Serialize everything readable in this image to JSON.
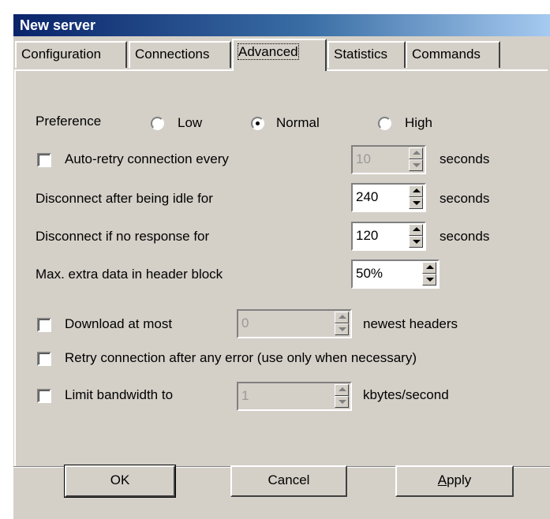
{
  "window": {
    "title": "New server"
  },
  "tabs": [
    {
      "label": "Configuration"
    },
    {
      "label": "Connections"
    },
    {
      "label": "Advanced",
      "active": true
    },
    {
      "label": "Statistics"
    },
    {
      "label": "Commands"
    }
  ],
  "preference": {
    "label": "Preference",
    "options": [
      {
        "label": "Low",
        "selected": false
      },
      {
        "label": "Normal",
        "selected": true
      },
      {
        "label": "High",
        "selected": false
      }
    ]
  },
  "auto_retry": {
    "label": "Auto-retry connection every",
    "checked": false,
    "value": "10",
    "unit": "seconds",
    "enabled": false
  },
  "idle_disconnect": {
    "label": "Disconnect after being idle for",
    "value": "240",
    "unit": "seconds"
  },
  "no_response": {
    "label": "Disconnect if no response for",
    "value": "120",
    "unit": "seconds"
  },
  "max_extra": {
    "label": "Max. extra data in header block",
    "value": "50%"
  },
  "download_most": {
    "label": "Download at most",
    "checked": false,
    "value": "0",
    "unit": "newest headers",
    "enabled": false
  },
  "retry_any_error": {
    "label": "Retry connection after any error (use only when necessary)",
    "checked": false
  },
  "limit_bandwidth": {
    "label": "Limit bandwidth to",
    "checked": false,
    "value": "1",
    "unit": "kbytes/second",
    "enabled": false
  },
  "buttons": {
    "ok": "OK",
    "cancel": "Cancel",
    "apply_mnemonic": "A",
    "apply_rest": "pply"
  },
  "colors": {
    "title_start": "#0a246a",
    "title_end": "#a6caf0",
    "face": "#d4d0c8"
  }
}
